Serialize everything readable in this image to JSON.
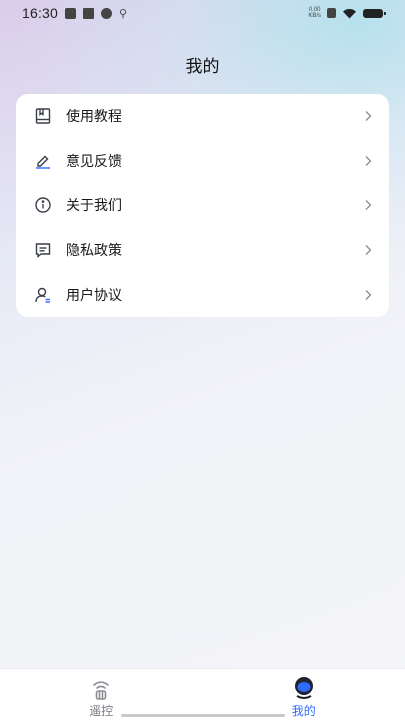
{
  "status_bar": {
    "time": "16:30",
    "net_speed_value": "0.00",
    "net_speed_unit": "KB/s",
    "left_icons": [
      "notification-icon",
      "mail-icon",
      "link-icon",
      "usb-icon"
    ],
    "right_icons": [
      "nfc-icon",
      "wifi-icon",
      "battery-icon"
    ]
  },
  "header": {
    "title": "我的"
  },
  "menu": {
    "items": [
      {
        "label": "使用教程",
        "icon": "book-icon"
      },
      {
        "label": "意见反馈",
        "icon": "edit-icon"
      },
      {
        "label": "关于我们",
        "icon": "info-icon"
      },
      {
        "label": "隐私政策",
        "icon": "message-icon"
      },
      {
        "label": "用户协议",
        "icon": "user-icon"
      }
    ]
  },
  "tab_bar": {
    "tabs": [
      {
        "label": "遥控",
        "icon": "remote-icon",
        "active": false
      },
      {
        "label": "我的",
        "icon": "profile-icon",
        "active": true
      }
    ]
  },
  "colors": {
    "accent": "#2f6bff",
    "icon_stroke": "#3a3f4a",
    "inactive_tab": "#7a7a80"
  }
}
